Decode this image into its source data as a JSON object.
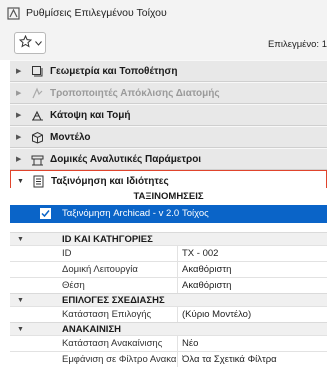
{
  "window": {
    "title": "Ρυθμίσεις Επιλεγμένου Τοίχου"
  },
  "toolbar": {
    "selected_label": "Επιλεγμένο: 1"
  },
  "panels": [
    {
      "label": "Γεωμετρία και Τοποθέτηση",
      "icon": "geometry-icon",
      "disabled": false
    },
    {
      "label": "Τροποποιητές Απόκλισης Διατομής",
      "icon": "profile-modifier-icon",
      "disabled": true
    },
    {
      "label": "Κάτοψη και Τομή",
      "icon": "floor-plan-icon",
      "disabled": false
    },
    {
      "label": "Μοντέλο",
      "icon": "model-icon",
      "disabled": false
    },
    {
      "label": "Δομικές Αναλυτικές Παράμετροι",
      "icon": "structural-analysis-icon",
      "disabled": false
    },
    {
      "label": "Ταξινόμηση και Ιδιότητες",
      "icon": "classification-icon",
      "disabled": false,
      "active": true
    }
  ],
  "classifications": {
    "header": "ΤΑΞΙΝΟΜΗΣΕΙΣ",
    "row": {
      "label": "Ταξινόμηση Archicad - v 2.0",
      "value": "Τοίχος",
      "checked": true
    }
  },
  "property_groups": [
    {
      "title": "ID ΚΑΙ ΚΑΤΗΓΟΡΙΕΣ",
      "rows": [
        {
          "key": "ID",
          "value": "TX - 002"
        },
        {
          "key": "Δομική Λειτουργία",
          "value": "Ακαθόριστη"
        },
        {
          "key": "Θέση",
          "value": "Ακαθόριστη"
        }
      ]
    },
    {
      "title": "ΕΠΙΛΟΓΕΣ ΣΧΕΔΙΑΣΗΣ",
      "rows": [
        {
          "key": "Κατάσταση Επιλογής",
          "value": "(Κύριο Μοντέλο)"
        }
      ]
    },
    {
      "title": "ΑΝΑΚΑΙΝΙΣΗ",
      "rows": [
        {
          "key": "Κατάσταση Ανακαίνισης",
          "value": "Νέο"
        },
        {
          "key": "Εμφάνιση σε Φίλτρο Ανακαί...",
          "value": "Όλα τα Σχετικά Φίλτρα"
        }
      ]
    }
  ],
  "colors": {
    "selection": "#0a64c8",
    "highlight_border": "#e0442c",
    "panel_bg": "#e8e8e8"
  }
}
